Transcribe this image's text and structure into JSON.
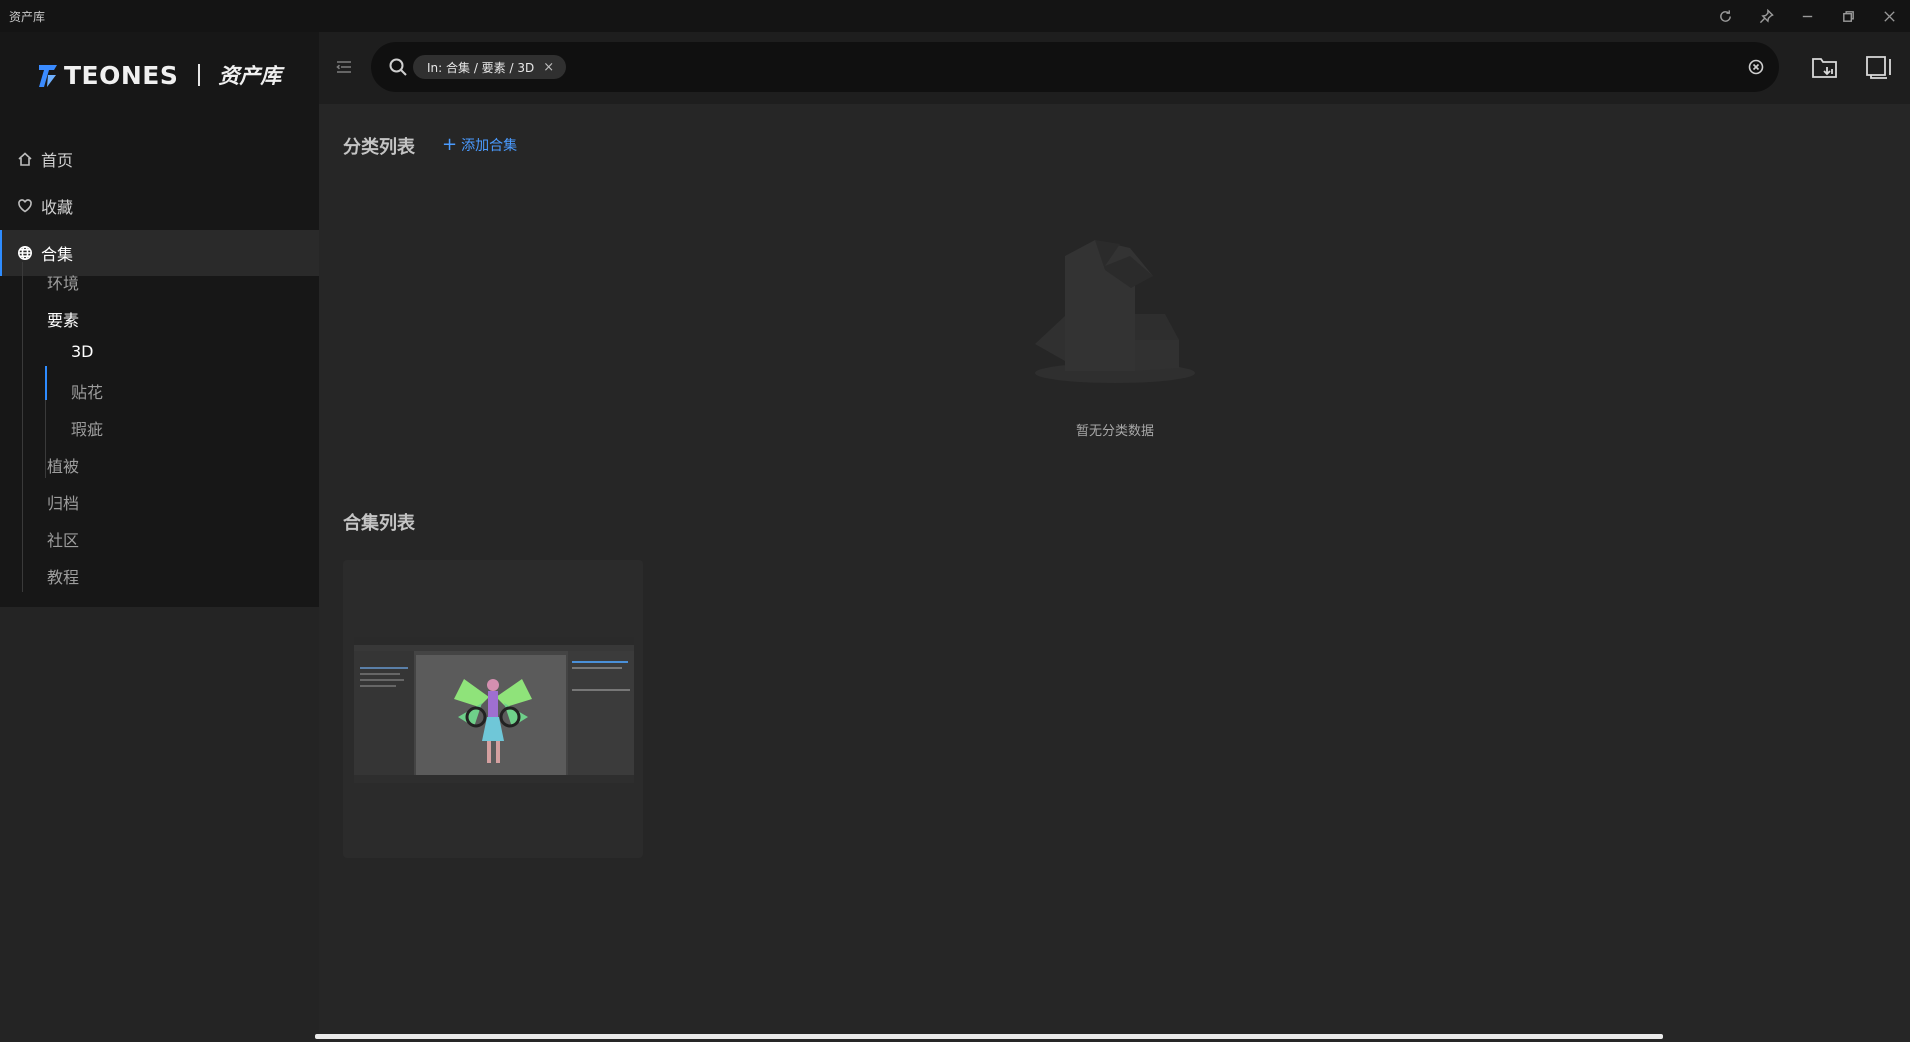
{
  "window": {
    "title": "资产库",
    "controls": [
      "refresh-icon",
      "pin-icon",
      "minimize-icon",
      "restore-icon",
      "close-icon"
    ]
  },
  "logo": {
    "brand": "TEONES",
    "name": "资产库"
  },
  "nav": {
    "items": [
      {
        "label": "首页",
        "icon": "home-icon"
      },
      {
        "label": "收藏",
        "icon": "heart-icon"
      },
      {
        "label": "合集",
        "icon": "globe-icon",
        "active": true
      }
    ]
  },
  "tree": {
    "items": [
      {
        "label": "环境"
      },
      {
        "label": "要素",
        "expanded": true,
        "children": [
          {
            "label": "3D",
            "selected": true
          },
          {
            "label": "贴花"
          },
          {
            "label": "瑕疵"
          }
        ]
      },
      {
        "label": "植被"
      },
      {
        "label": "归档"
      },
      {
        "label": "社区"
      },
      {
        "label": "教程"
      }
    ]
  },
  "search": {
    "tag": "In: 合集 / 要素 / 3D",
    "tag_close": "×",
    "value": "",
    "placeholder": ""
  },
  "main": {
    "category_title": "分类列表",
    "add_collection_label": "添加合集",
    "empty_text": "暂无分类数据",
    "collection_title": "合集列表"
  },
  "colors": {
    "accent": "#2e8cff",
    "link": "#4a9bff",
    "sidebar_bg": "#171717",
    "main_bg": "#262626",
    "header_bg": "#1e1e1e"
  }
}
